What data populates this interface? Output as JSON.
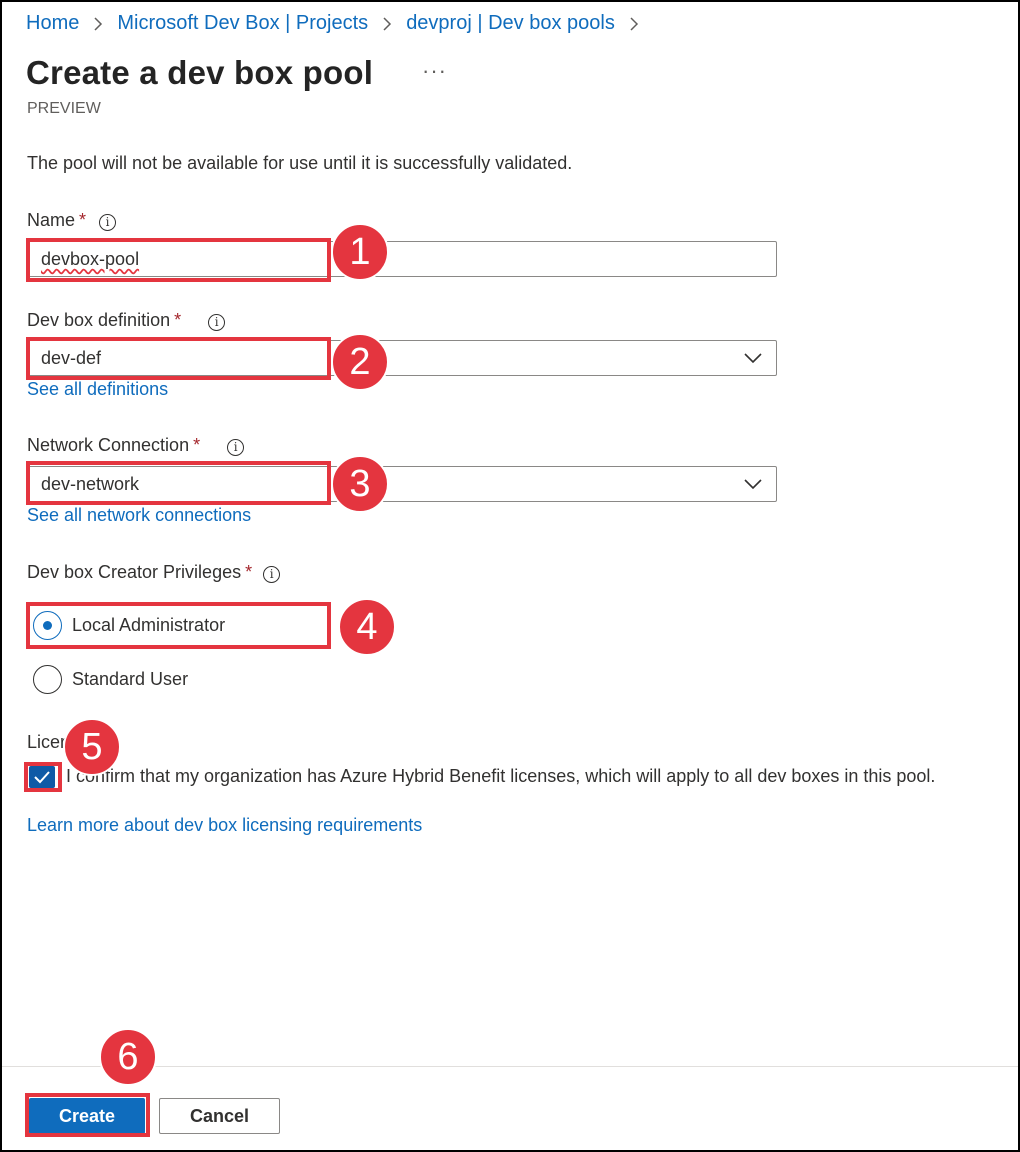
{
  "breadcrumb": [
    {
      "label": "Home"
    },
    {
      "label": "Microsoft Dev Box | Projects"
    },
    {
      "label": "devproj | Dev box pools"
    }
  ],
  "page": {
    "title": "Create a dev box pool",
    "more_label": "···",
    "subtitle": "PREVIEW",
    "note": "The pool will not be available for use until it is successfully validated."
  },
  "form": {
    "name": {
      "label": "Name",
      "required": "*",
      "value": "devbox-pool"
    },
    "definition": {
      "label": "Dev box definition",
      "required": "*",
      "value": "dev-def",
      "link": "See all definitions"
    },
    "network": {
      "label": "Network Connection",
      "required": "*",
      "value": "dev-network",
      "link": "See all network connections"
    },
    "privileges": {
      "label": "Dev box Creator Privileges",
      "required": "*",
      "options": [
        {
          "label": "Local Administrator",
          "selected": true
        },
        {
          "label": "Standard User",
          "selected": false
        }
      ]
    },
    "licensing": {
      "label_visible": "Licer",
      "checkbox_label": "I confirm that my organization has Azure Hybrid Benefit licenses, which will apply to all dev boxes in this pool.",
      "checked": true,
      "link": "Learn more about dev box licensing requirements"
    }
  },
  "buttons": {
    "create": "Create",
    "cancel": "Cancel"
  },
  "annotations": {
    "n1": "1",
    "n2": "2",
    "n3": "3",
    "n4": "4",
    "n5": "5",
    "n6": "6"
  },
  "icons": {
    "info": "info-icon",
    "chevron_down": "chevron-down-icon",
    "chevron_right": "chevron-right-icon",
    "check": "check-icon"
  },
  "colors": {
    "accent": "#0f6cbd",
    "required": "#a4262c",
    "annotation": "#e4353f",
    "checkbox": "#0f5aa6"
  }
}
